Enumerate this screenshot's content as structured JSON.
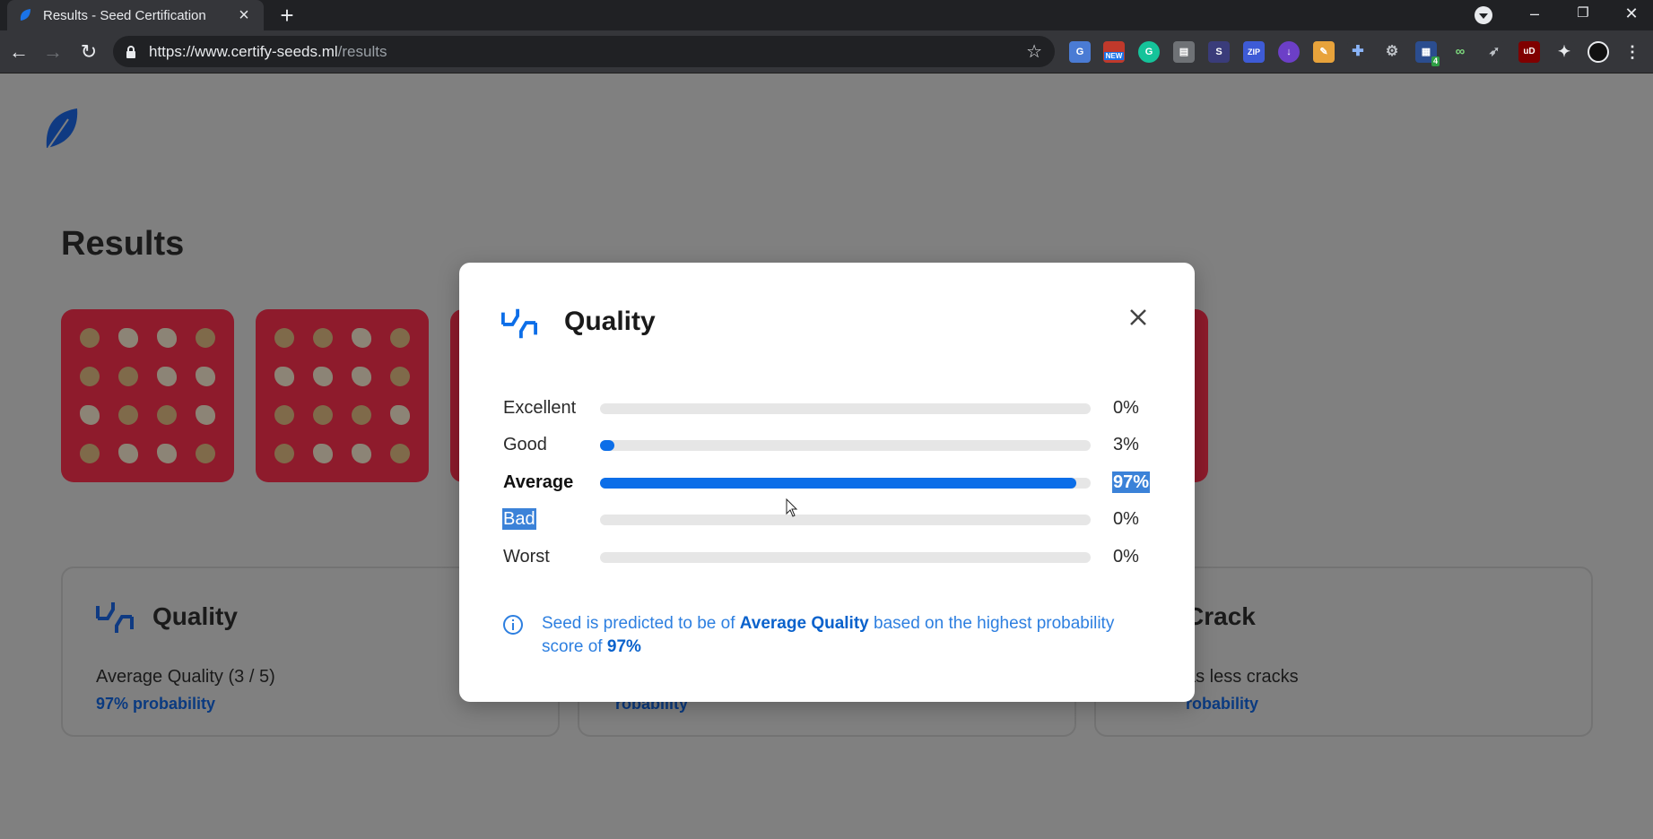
{
  "browser": {
    "tab_title": "Results - Seed Certification",
    "url_host": "https://www.certify-seeds.ml",
    "url_path": "/results",
    "extensions": [
      "google-translate-icon",
      "new-badge-extension-icon",
      "grammarly-icon",
      "copy-extension-icon",
      "s-extension-icon",
      "zip-extension-icon",
      "download-extension-icon",
      "note-extension-icon",
      "plus-extension-icon",
      "gear-extension-icon",
      "calendar-extension-icon",
      "glasses-extension-icon",
      "rocket-extension-icon",
      "ublock-icon",
      "puzzle-icon",
      "profile-avatar"
    ],
    "ext_badges": {
      "new": "NEW",
      "zip": "ZIP",
      "s": "S",
      "ublock": "uD",
      "calendar_count": "4"
    }
  },
  "page": {
    "title": "Results",
    "cards": [
      {
        "title": "Quality",
        "desc": "Average Quality (3 / 5)",
        "prob": "97% probability"
      },
      {
        "title": "",
        "desc": "",
        "prob": "robability"
      },
      {
        "title": "Crack",
        "desc": "as less cracks",
        "prob": "robability"
      }
    ]
  },
  "modal": {
    "title": "Quality",
    "rows": [
      {
        "label": "Excellent",
        "value": 0,
        "pct": "0%"
      },
      {
        "label": "Good",
        "value": 3,
        "pct": "3%"
      },
      {
        "label": "Average",
        "value": 97,
        "pct": "97%"
      },
      {
        "label": "Bad",
        "value": 0,
        "pct": "0%"
      },
      {
        "label": "Worst",
        "value": 0,
        "pct": "0%"
      }
    ],
    "info": {
      "pre": "Seed is predicted to be of ",
      "quality": "Average Quality",
      "mid": " based on the highest probability score of ",
      "score": "97%"
    }
  },
  "colors": {
    "accent": "#0c6ee8",
    "selection": "#3b82d8",
    "track": "#e6e6e6"
  }
}
